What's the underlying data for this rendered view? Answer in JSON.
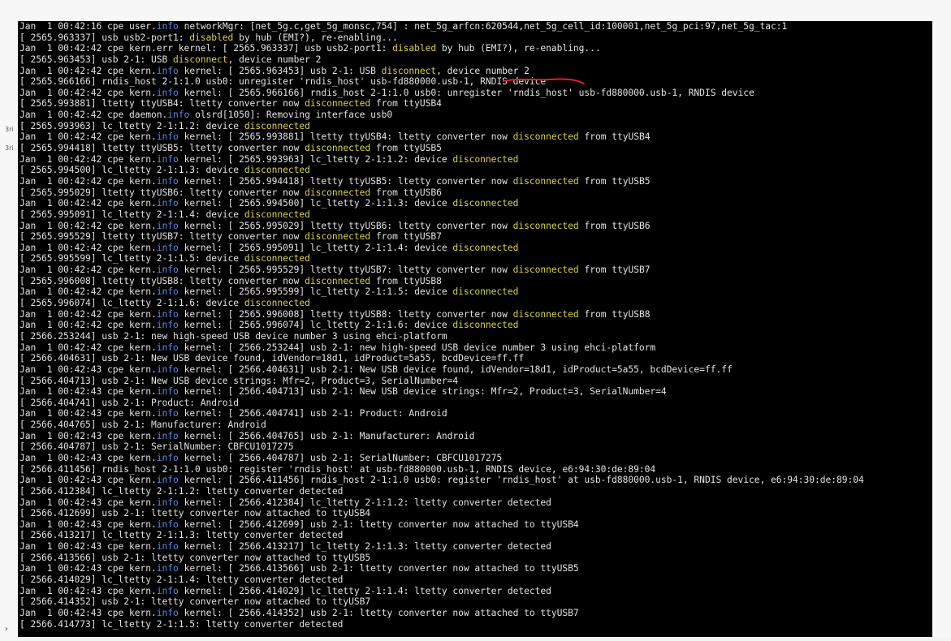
{
  "terminal": {
    "lines": [
      [
        [
          "",
          "Jan  1 00:42:16 cpe user."
        ],
        [
          "b",
          "info"
        ],
        [
          "",
          " networkMgr: [net_5g.c,get_5g_monsc,754] : net_5g_arfcn:620544,net_5g_cell_id:100001,net_5g_pci:97,net_5g_tac:1"
        ]
      ],
      [
        [
          "",
          "[ 2565.963337] usb usb2-port1: "
        ],
        [
          "y",
          "disabled"
        ],
        [
          "",
          " by hub (EMI?), re-enabling..."
        ]
      ],
      [
        [
          "",
          "Jan  1 00:42:42 cpe kern.err kernel: [ 2565.963337] usb usb2-port1: "
        ],
        [
          "y",
          "disabled"
        ],
        [
          "",
          " by hub (EMI?), re-enabling..."
        ]
      ],
      [
        [
          "",
          "[ 2565.963453] usb 2-1: USB "
        ],
        [
          "y",
          "disconnect"
        ],
        [
          "",
          ", device number 2"
        ]
      ],
      [
        [
          "",
          "Jan  1 00:42:42 cpe kern."
        ],
        [
          "b",
          "info"
        ],
        [
          "",
          " kernel: [ 2565.963453] usb 2-1: USB "
        ],
        [
          "y",
          "disconnect"
        ],
        [
          "",
          ", device number 2"
        ]
      ],
      [
        [
          "",
          "[ 2565.966166] rndis_host 2-1:1.0 usb0: unregister 'rndis_host' usb-fd880000.usb-1, RNDIS device"
        ]
      ],
      [
        [
          "",
          "Jan  1 00:42:42 cpe kern."
        ],
        [
          "b",
          "info"
        ],
        [
          "",
          " kernel: [ 2565.966166] rndis_host 2-1:1.0 usb0: unregister 'rndis_host' usb-fd880000.usb-1, RNDIS device"
        ]
      ],
      [
        [
          "",
          "[ 2565.993881] ltetty ttyUSB4: ltetty converter now "
        ],
        [
          "y",
          "disconnected"
        ],
        [
          "",
          " from ttyUSB4"
        ]
      ],
      [
        [
          "",
          "Jan  1 00:42:42 cpe daemon."
        ],
        [
          "b",
          "info"
        ],
        [
          "",
          " olsrd[1050]: Removing interface usb0"
        ]
      ],
      [
        [
          "",
          "[ 2565.993963] lc_ltetty 2-1:1.2: device "
        ],
        [
          "y",
          "disconnected"
        ]
      ],
      [
        [
          "",
          "Jan  1 00:42:42 cpe kern."
        ],
        [
          "b",
          "info"
        ],
        [
          "",
          " kernel: [ 2565.993881] ltetty ttyUSB4: ltetty converter now "
        ],
        [
          "y",
          "disconnected"
        ],
        [
          "",
          " from ttyUSB4"
        ]
      ],
      [
        [
          "",
          "[ 2565.994418] ltetty ttyUSB5: ltetty converter now "
        ],
        [
          "y",
          "disconnected"
        ],
        [
          "",
          " from ttyUSB5"
        ]
      ],
      [
        [
          "",
          "Jan  1 00:42:42 cpe kern."
        ],
        [
          "b",
          "info"
        ],
        [
          "",
          " kernel: [ 2565.993963] lc_ltetty 2-1:1.2: device "
        ],
        [
          "y",
          "disconnected"
        ]
      ],
      [
        [
          "",
          "[ 2565.994500] lc_ltetty 2-1:1.3: device "
        ],
        [
          "y",
          "disconnected"
        ]
      ],
      [
        [
          "",
          "Jan  1 00:42:42 cpe kern."
        ],
        [
          "b",
          "info"
        ],
        [
          "",
          " kernel: [ 2565.994418] ltetty ttyUSB5: ltetty converter now "
        ],
        [
          "y",
          "disconnected"
        ],
        [
          "",
          " from ttyUSB5"
        ]
      ],
      [
        [
          "",
          "[ 2565.995029] ltetty ttyUSB6: ltetty converter now "
        ],
        [
          "y",
          "disconnected"
        ],
        [
          "",
          " from ttyUSB6"
        ]
      ],
      [
        [
          "",
          "Jan  1 00:42:42 cpe kern."
        ],
        [
          "b",
          "info"
        ],
        [
          "",
          " kernel: [ 2565.994500] lc_ltetty 2-1:1.3: device "
        ],
        [
          "y",
          "disconnected"
        ]
      ],
      [
        [
          "",
          "[ 2565.995091] lc_ltetty 2-1:1.4: device "
        ],
        [
          "y",
          "disconnected"
        ]
      ],
      [
        [
          "",
          "Jan  1 00:42:42 cpe kern."
        ],
        [
          "b",
          "info"
        ],
        [
          "",
          " kernel: [ 2565.995029] ltetty ttyUSB6: ltetty converter now "
        ],
        [
          "y",
          "disconnected"
        ],
        [
          "",
          " from ttyUSB6"
        ]
      ],
      [
        [
          "",
          "[ 2565.995529] ltetty ttyUSB7: ltetty converter now "
        ],
        [
          "y",
          "disconnected"
        ],
        [
          "",
          " from ttyUSB7"
        ]
      ],
      [
        [
          "",
          "Jan  1 00:42:42 cpe kern."
        ],
        [
          "b",
          "info"
        ],
        [
          "",
          " kernel: [ 2565.995091] lc_ltetty 2-1:1.4: device "
        ],
        [
          "y",
          "disconnected"
        ]
      ],
      [
        [
          "",
          "[ 2565.995599] lc_ltetty 2-1:1.5: device "
        ],
        [
          "y",
          "disconnected"
        ]
      ],
      [
        [
          "",
          "Jan  1 00:42:42 cpe kern."
        ],
        [
          "b",
          "info"
        ],
        [
          "",
          " kernel: [ 2565.995529] ltetty ttyUSB7: ltetty converter now "
        ],
        [
          "y",
          "disconnected"
        ],
        [
          "",
          " from ttyUSB7"
        ]
      ],
      [
        [
          "",
          "[ 2565.996008] ltetty ttyUSB8: ltetty converter now "
        ],
        [
          "y",
          "disconnected"
        ],
        [
          "",
          " from ttyUSB8"
        ]
      ],
      [
        [
          "",
          "Jan  1 00:42:42 cpe kern."
        ],
        [
          "b",
          "info"
        ],
        [
          "",
          " kernel: [ 2565.995599] lc_ltetty 2-1:1.5: device "
        ],
        [
          "y",
          "disconnected"
        ]
      ],
      [
        [
          "",
          "[ 2565.996074] lc_ltetty 2-1:1.6: device "
        ],
        [
          "y",
          "disconnected"
        ]
      ],
      [
        [
          "",
          "Jan  1 00:42:42 cpe kern."
        ],
        [
          "b",
          "info"
        ],
        [
          "",
          " kernel: [ 2565.996008] ltetty ttyUSB8: ltetty converter now "
        ],
        [
          "y",
          "disconnected"
        ],
        [
          "",
          " from ttyUSB8"
        ]
      ],
      [
        [
          "",
          "Jan  1 00:42:42 cpe kern."
        ],
        [
          "b",
          "info"
        ],
        [
          "",
          " kernel: [ 2565.996074] lc_ltetty 2-1:1.6: device "
        ],
        [
          "y",
          "disconnected"
        ]
      ],
      [
        [
          "",
          "[ 2566.253244] usb 2-1: new high-speed USB device number 3 using ehci-platform"
        ]
      ],
      [
        [
          "",
          "Jan  1 00:42:42 cpe kern."
        ],
        [
          "b",
          "info"
        ],
        [
          "",
          " kernel: [ 2566.253244] usb 2-1: new high-speed USB device number 3 using ehci-platform"
        ]
      ],
      [
        [
          "",
          "[ 2566.404631] usb 2-1: New USB device found, idVendor=18d1, idProduct=5a55, bcdDevice=ff.ff"
        ]
      ],
      [
        [
          "",
          "Jan  1 00:42:43 cpe kern."
        ],
        [
          "b",
          "info"
        ],
        [
          "",
          " kernel: [ 2566.404631] usb 2-1: New USB device found, idVendor=18d1, idProduct=5a55, bcdDevice=ff.ff"
        ]
      ],
      [
        [
          "",
          "[ 2566.404713] usb 2-1: New USB device strings: Mfr=2, Product=3, SerialNumber=4"
        ]
      ],
      [
        [
          "",
          "Jan  1 00:42:43 cpe kern."
        ],
        [
          "b",
          "info"
        ],
        [
          "",
          " kernel: [ 2566.404713] usb 2-1: New USB device strings: Mfr=2, Product=3, SerialNumber=4"
        ]
      ],
      [
        [
          "",
          "[ 2566.404741] usb 2-1: Product: Android"
        ]
      ],
      [
        [
          "",
          "Jan  1 00:42:43 cpe kern."
        ],
        [
          "b",
          "info"
        ],
        [
          "",
          " kernel: [ 2566.404741] usb 2-1: Product: Android"
        ]
      ],
      [
        [
          "",
          "[ 2566.404765] usb 2-1: Manufacturer: Android"
        ]
      ],
      [
        [
          "",
          "Jan  1 00:42:43 cpe kern."
        ],
        [
          "b",
          "info"
        ],
        [
          "",
          " kernel: [ 2566.404765] usb 2-1: Manufacturer: Android"
        ]
      ],
      [
        [
          "",
          "[ 2566.404787] usb 2-1: SerialNumber: CBFCU1017275"
        ]
      ],
      [
        [
          "",
          "Jan  1 00:42:43 cpe kern."
        ],
        [
          "b",
          "info"
        ],
        [
          "",
          " kernel: [ 2566.404787] usb 2-1: SerialNumber: CBFCU1017275"
        ]
      ],
      [
        [
          "",
          "[ 2566.411456] rndis_host 2-1:1.0 usb0: register 'rndis_host' at usb-fd880000.usb-1, RNDIS device, e6:94:30:de:89:04"
        ]
      ],
      [
        [
          "",
          "Jan  1 00:42:43 cpe kern."
        ],
        [
          "b",
          "info"
        ],
        [
          "",
          " kernel: [ 2566.411456] rndis_host 2-1:1.0 usb0: register 'rndis_host' at usb-fd880000.usb-1, RNDIS device, e6:94:30:de:89:04"
        ]
      ],
      [
        [
          "",
          "[ 2566.412384] lc_ltetty 2-1:1.2: ltetty converter detected"
        ]
      ],
      [
        [
          "",
          "Jan  1 00:42:43 cpe kern."
        ],
        [
          "b",
          "info"
        ],
        [
          "",
          " kernel: [ 2566.412384] lc_ltetty 2-1:1.2: ltetty converter detected"
        ]
      ],
      [
        [
          "",
          "[ 2566.412699] usb 2-1: ltetty converter now attached to ttyUSB4"
        ]
      ],
      [
        [
          "",
          "Jan  1 00:42:43 cpe kern."
        ],
        [
          "b",
          "info"
        ],
        [
          "",
          " kernel: [ 2566.412699] usb 2-1: ltetty converter now attached to ttyUSB4"
        ]
      ],
      [
        [
          "",
          "[ 2566.413217] lc_ltetty 2-1:1.3: ltetty converter detected"
        ]
      ],
      [
        [
          "",
          "Jan  1 00:42:43 cpe kern."
        ],
        [
          "b",
          "info"
        ],
        [
          "",
          " kernel: [ 2566.413217] lc_ltetty 2-1:1.3: ltetty converter detected"
        ]
      ],
      [
        [
          "",
          "[ 2566.413566] usb 2-1: ltetty converter now attached to ttyUSB5"
        ]
      ],
      [
        [
          "",
          "Jan  1 00:42:43 cpe kern."
        ],
        [
          "b",
          "info"
        ],
        [
          "",
          " kernel: [ 2566.413566] usb 2-1: ltetty converter now attached to ttyUSB5"
        ]
      ],
      [
        [
          "",
          "[ 2566.414029] lc_ltetty 2-1:1.4: ltetty converter detected"
        ]
      ],
      [
        [
          "",
          "Jan  1 00:42:43 cpe kern."
        ],
        [
          "b",
          "info"
        ],
        [
          "",
          " kernel: [ 2566.414029] lc_ltetty 2-1:1.4: ltetty converter detected"
        ]
      ],
      [
        [
          "",
          "[ 2566.414352] usb 2-1: ltetty converter now attached to ttyUSB7"
        ]
      ],
      [
        [
          "",
          "Jan  1 00:42:43 cpe kern."
        ],
        [
          "b",
          "info"
        ],
        [
          "",
          " kernel: [ 2566.414352] usb 2-1: ltetty converter now attached to ttyUSB7"
        ]
      ],
      [
        [
          "",
          "[ 2566.414773] lc_ltetty 2-1:1.5: ltetty converter detected"
        ]
      ]
    ]
  },
  "gutter": {
    "mark_1": "3ri",
    "mark_2": "3ri",
    "expand_arrow": "›"
  },
  "colors": {
    "background": "#000000",
    "text": "#e2e2e2",
    "keyword_info": "#5a8ee0",
    "keyword_status": "#d8d34a",
    "annotation": "#d9232a"
  }
}
